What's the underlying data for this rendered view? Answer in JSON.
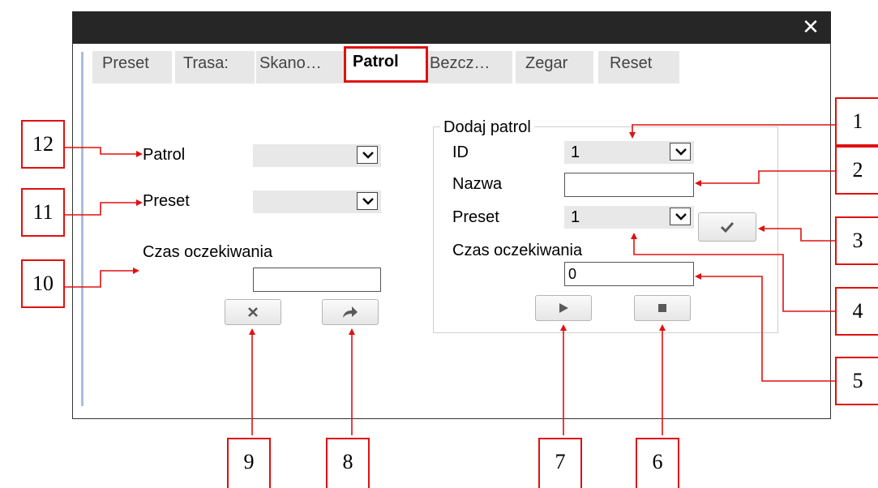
{
  "window": {
    "close_glyph": "✕"
  },
  "tabs": [
    {
      "label": "Preset",
      "active": false
    },
    {
      "label": "Trasa:",
      "active": false
    },
    {
      "label": "Skano…",
      "active": false
    },
    {
      "label": "Patrol",
      "active": true
    },
    {
      "label": "Bezcz…",
      "active": false
    },
    {
      "label": "Zegar",
      "active": false
    },
    {
      "label": "Reset",
      "active": false
    }
  ],
  "left_panel": {
    "patrol_label": "Patrol",
    "patrol_value": "",
    "preset_label": "Preset",
    "preset_value": "",
    "wait_label": "Czas oczekiwania",
    "wait_value": "",
    "delete_icon": "close-icon",
    "call_icon": "forward-arrow-icon"
  },
  "add_patrol": {
    "title": "Dodaj patrol",
    "id_label": "ID",
    "id_value": "1",
    "name_label": "Nazwa",
    "name_value": "",
    "preset_label": "Preset",
    "preset_value": "1",
    "wait_label": "Czas oczekiwania",
    "wait_value": "0",
    "confirm_icon": "checkmark-icon",
    "play_icon": "play-icon",
    "stop_icon": "stop-icon"
  },
  "callouts": [
    "1",
    "2",
    "3",
    "4",
    "5",
    "6",
    "7",
    "8",
    "9",
    "10",
    "11",
    "12"
  ],
  "colors": {
    "callout_red": "#e01010",
    "titlebar": "#262626",
    "tab_bg": "#e7e7e7",
    "select_bg": "#e8e8e8",
    "left_rule": "#a8bfd9"
  }
}
